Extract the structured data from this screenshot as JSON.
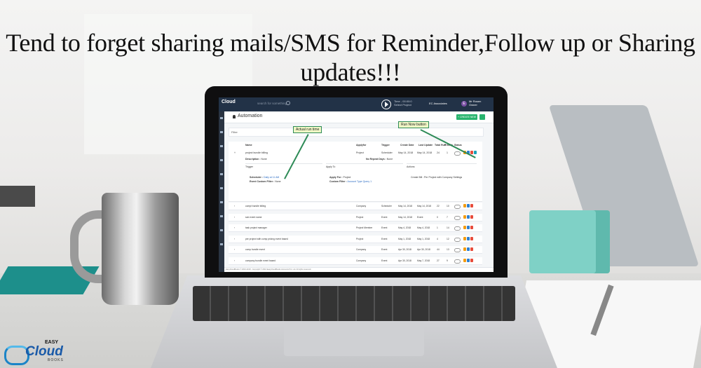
{
  "headline": "Tend to forget sharing mails/SMS for Reminder,Follow up or Sharing updates!!!",
  "app": {
    "logo": "Cloud",
    "search_placeholder": "search for something...",
    "timer_line1": "Time - 00:00:0",
    "timer_line2": "Select Project",
    "org": "EC Associates",
    "avatar_initial": "E",
    "user_name": "Mr Rosen",
    "user_role": "Owner",
    "page_title": "Automation",
    "create_button": "+ CREATE NEW",
    "filter_label": "Filter",
    "columns": [
      "Name",
      "Applyfor",
      "Trigger",
      "Create Date",
      "Last Update",
      "Total Run",
      "Priority",
      "Status"
    ],
    "expanded": {
      "name": "project bundle billing",
      "apply_for": "Project",
      "trigger": "Scheduler",
      "create_date": "May 14, 2018",
      "last_update": "May 14, 2018",
      "total_run": "24",
      "priority": "1",
      "description_label": "Description :",
      "description_value": "None",
      "repeat_label": "No Repeat Days :",
      "repeat_value": "None",
      "trigger_label": "Trigger",
      "apply_label": "Apply To",
      "actions_label": "Actions",
      "scheduler_label": "Scheduler :",
      "scheduler_value": "Daily at 11 AM",
      "event_filter_label": "Event Custom Filter :",
      "event_filter_value": "None",
      "apply_for_label": "Apply For :",
      "apply_for_value": "Project",
      "custom_filter_label": "Custom Filter :",
      "custom_filter_value": "Account Type Query 1",
      "action_text": "Create Bill : Per Project with Company Settings"
    },
    "rows": [
      {
        "name": "compt bundle billing",
        "apply": "Company",
        "trigger": "Scheduler",
        "create": "May 14, 2018",
        "update": "May 14, 2018",
        "run": "22",
        "priority": "10"
      },
      {
        "name": "sub event name",
        "apply": "Project",
        "trigger": "Event",
        "create": "May 14, 2018",
        "update": "Event",
        "run": "0",
        "priority": "7"
      },
      {
        "name": "task project manager",
        "apply": "Project Member",
        "trigger": "Event",
        "create": "May 4, 2018",
        "update": "May 4, 2018",
        "run": "1",
        "priority": "14"
      },
      {
        "name": "per project with comp pricing event based",
        "apply": "Project",
        "trigger": "Event",
        "create": "May 1, 2018",
        "update": "May 1, 2018",
        "run": "4",
        "priority": "12"
      },
      {
        "name": "comp bundle event",
        "apply": "Company",
        "trigger": "Event",
        "create": "Apr 30, 2018",
        "update": "Apr 30, 2018",
        "run": "44",
        "priority": "13"
      },
      {
        "name": "company bundle event based",
        "apply": "Company",
        "trigger": "Event",
        "create": "Apr 30, 2018",
        "update": "May 7, 2018",
        "run": "27",
        "priority": "9"
      }
    ],
    "footer": "EasyCloudBooks © 2016-2018 - Copyright © 2016 EasyCloudBooks Accounts Pvt. Ltd. All rights reserved."
  },
  "callouts": {
    "actual_run_time": "Actual run time",
    "run_now_button": "Run Now button"
  },
  "brand": {
    "easy": "EASY",
    "cloud": "Cloud",
    "books": "BOOKS"
  },
  "colors": {
    "topbar": "#223247",
    "accent_green": "#28b46e",
    "callout_border": "#2e8b57",
    "callout_fill": "#f0f7c5",
    "action_orange": "#f39c12",
    "action_blue": "#2d7fd1",
    "action_red": "#e74c3c",
    "brand_blue": "#1a5aa8"
  }
}
